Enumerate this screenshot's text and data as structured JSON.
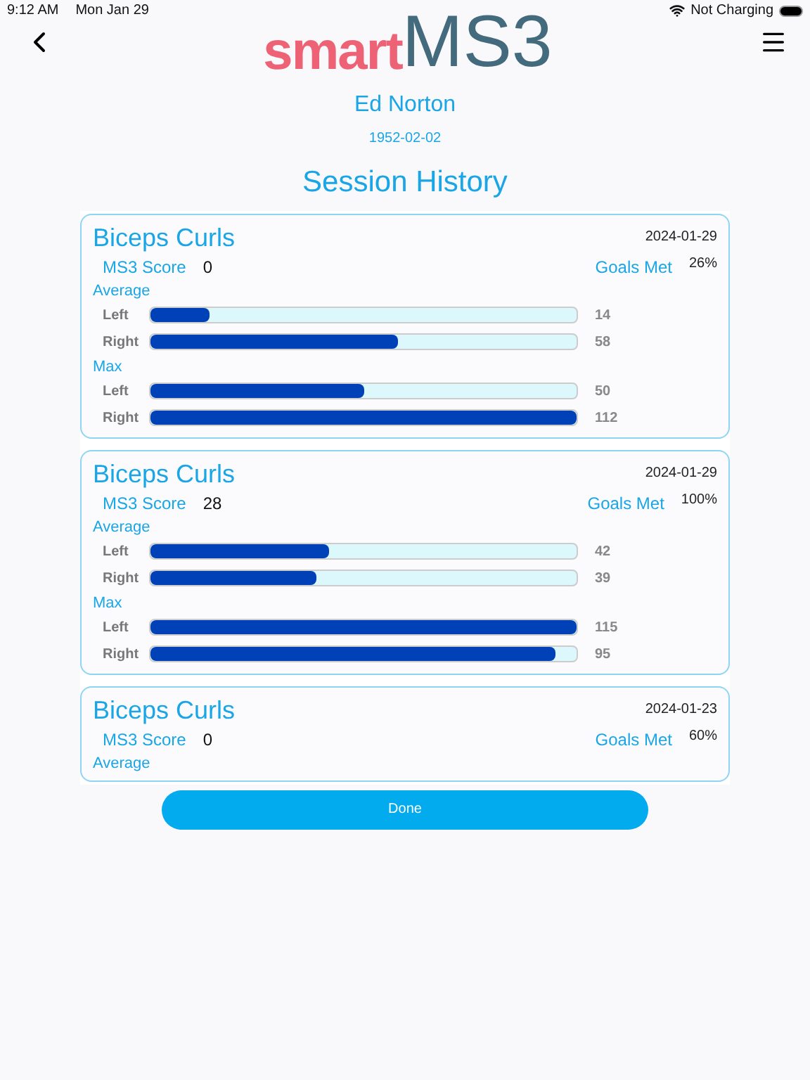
{
  "status_bar": {
    "time": "9:12 AM",
    "date": "Mon Jan 29",
    "charging": "Not Charging"
  },
  "logo": {
    "part_1": "smart",
    "part_2": "MS3"
  },
  "patient": {
    "name": "Ed Norton",
    "birth_date": "1952-02-02"
  },
  "title": "Session History",
  "sessions": [
    {
      "exercise": "Biceps Curls",
      "date": "2024-01-29",
      "score_label": "MS3 Score",
      "score": "0",
      "goals_label": "Goals Met",
      "goals": "26%",
      "groups": [
        {
          "label": "Average",
          "bars": [
            {
              "side": "Left",
              "level": 0.14,
              "reading": "14"
            },
            {
              "side": "Right",
              "level": 0.58,
              "reading": "58"
            }
          ]
        },
        {
          "label": "Max",
          "bars": [
            {
              "side": "Left",
              "level": 0.5,
              "reading": "50"
            },
            {
              "side": "Right",
              "level": 1,
              "reading": "112"
            }
          ]
        }
      ]
    },
    {
      "exercise": "Biceps Curls",
      "date": "2024-01-29",
      "score_label": "MS3 Score",
      "score": "28",
      "goals_label": "Goals Met",
      "goals": "100%",
      "groups": [
        {
          "label": "Average",
          "bars": [
            {
              "side": "Left",
              "level": 0.42,
              "reading": "42"
            },
            {
              "side": "Right",
              "level": 0.39,
              "reading": "39"
            }
          ]
        },
        {
          "label": "Max",
          "bars": [
            {
              "side": "Left",
              "level": 1,
              "reading": "115"
            },
            {
              "side": "Right",
              "level": 0.95,
              "reading": "95"
            }
          ]
        }
      ]
    },
    {
      "exercise": "Biceps Curls",
      "date": "2024-01-23",
      "score_label": "MS3 Score",
      "score": "0",
      "goals_label": "Goals Met",
      "goals": "60%",
      "groups": [
        {
          "label": "Average"
        }
      ]
    }
  ],
  "done_button": "Done"
}
